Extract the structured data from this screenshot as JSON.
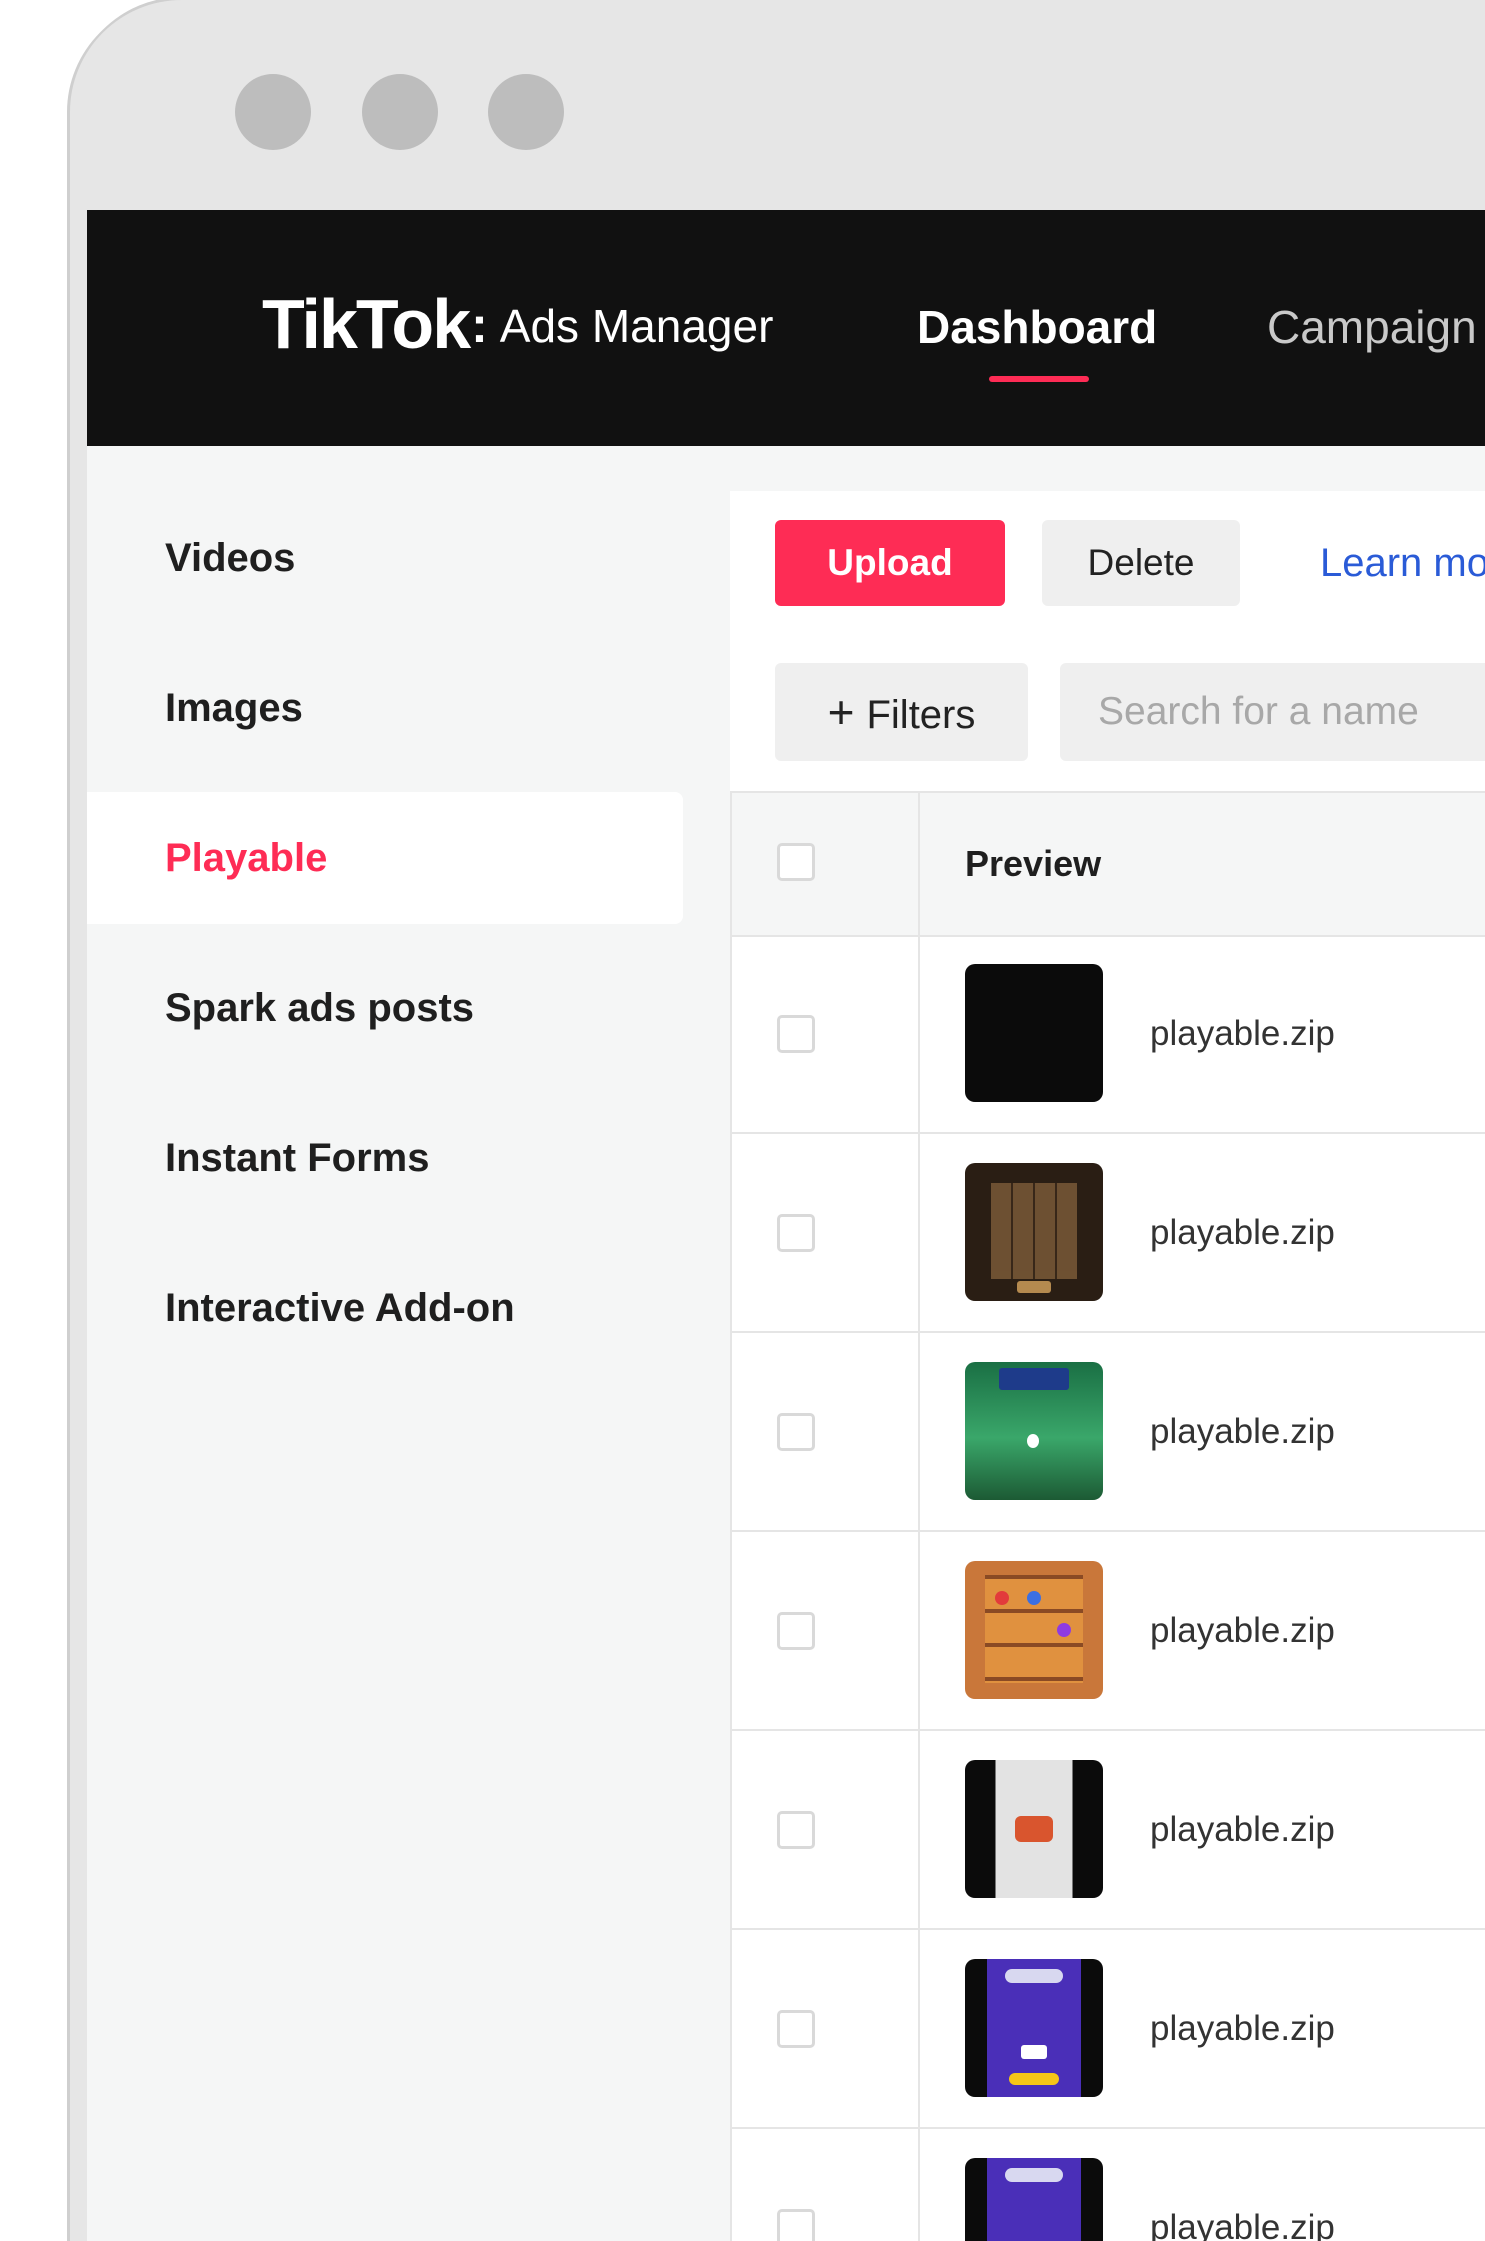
{
  "window": {
    "traffic_lights": [
      "window-dot",
      "window-dot",
      "window-dot"
    ]
  },
  "topbar": {
    "brand_main": "TikTok",
    "brand_colon": ":",
    "brand_sub": "Ads Manager",
    "nav": [
      {
        "label": "Dashboard",
        "active": true
      },
      {
        "label": "Campaign",
        "active": false
      }
    ],
    "accent_color": "#fe2c55"
  },
  "sidebar": {
    "items": [
      {
        "label": "Videos",
        "active": false
      },
      {
        "label": "Images",
        "active": false
      },
      {
        "label": "Playable",
        "active": true
      },
      {
        "label": "Spark ads posts",
        "active": false
      },
      {
        "label": "Instant Forms",
        "active": false
      },
      {
        "label": "Interactive Add-on",
        "active": false
      }
    ]
  },
  "toolbar": {
    "upload_label": "Upload",
    "delete_label": "Delete",
    "learn_more_label": "Learn mo"
  },
  "filters": {
    "plus_icon": "+",
    "filters_label": "Filters",
    "search_placeholder": "Search for a name",
    "search_value": ""
  },
  "table": {
    "columns": [
      "Preview"
    ],
    "rows": [
      {
        "file": "playable.zip",
        "thumb": "black"
      },
      {
        "file": "playable.zip",
        "thumb": "puzzle-brown"
      },
      {
        "file": "playable.zip",
        "thumb": "green-forest"
      },
      {
        "file": "playable.zip",
        "thumb": "orange-shelf"
      },
      {
        "file": "playable.zip",
        "thumb": "gray-logo"
      },
      {
        "file": "playable.zip",
        "thumb": "purple-game"
      },
      {
        "file": "playable.zip",
        "thumb": "purple-game"
      }
    ]
  }
}
